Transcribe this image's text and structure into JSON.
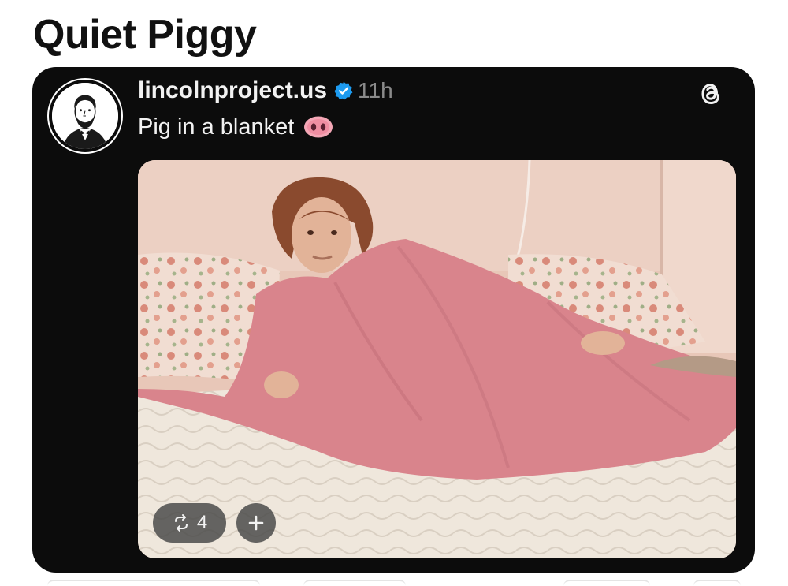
{
  "page": {
    "title": "Quiet Piggy"
  },
  "post": {
    "username": "lincolnproject.us",
    "verified": true,
    "time_ago": "11h",
    "caption": "Pig in a blanket",
    "caption_emoji": "pig-nose-icon",
    "avatar": "abraham-lincoln-portrait-avatar",
    "platform_icon": "threads-icon",
    "image": "photo-man-lying-in-bed-under-pink-blanket",
    "repost_count": "4",
    "actions": {
      "repost_icon": "repost-icon",
      "add_icon": "plus-icon"
    }
  },
  "colors": {
    "background": "#ffffff",
    "card": "#0c0c0c",
    "verified_blue": "#1d9bf0",
    "pig_pink": "#f4a7b6",
    "blanket_pink": "#d9848c"
  }
}
